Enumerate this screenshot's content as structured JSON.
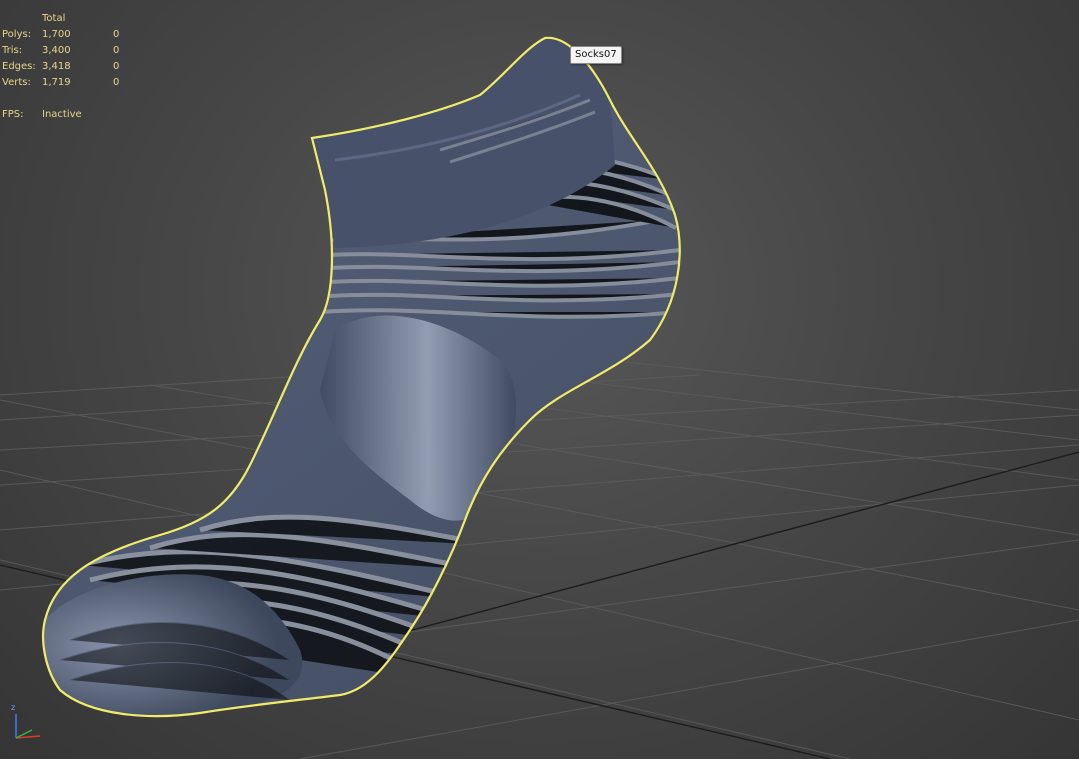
{
  "viewport": {
    "background": "#474747",
    "grid_color": "#5c5c5c"
  },
  "stats": {
    "header": "Total",
    "rows": [
      {
        "label": "Polys:",
        "total": "1,700",
        "selected": "0"
      },
      {
        "label": "Tris:",
        "total": "3,400",
        "selected": "0"
      },
      {
        "label": "Edges:",
        "total": "3,418",
        "selected": "0"
      },
      {
        "label": "Verts:",
        "total": "1,719",
        "selected": "0"
      }
    ],
    "fps_label": "FPS:",
    "fps_value": "Inactive",
    "text_color": "#e8d58a"
  },
  "object_tooltip": "Socks07",
  "selection_outline_color": "#f0ec6a",
  "sock_color": "#4a5670",
  "axis_gizmo": {
    "z_label": "z",
    "icon": "axis-tripod-icon"
  }
}
